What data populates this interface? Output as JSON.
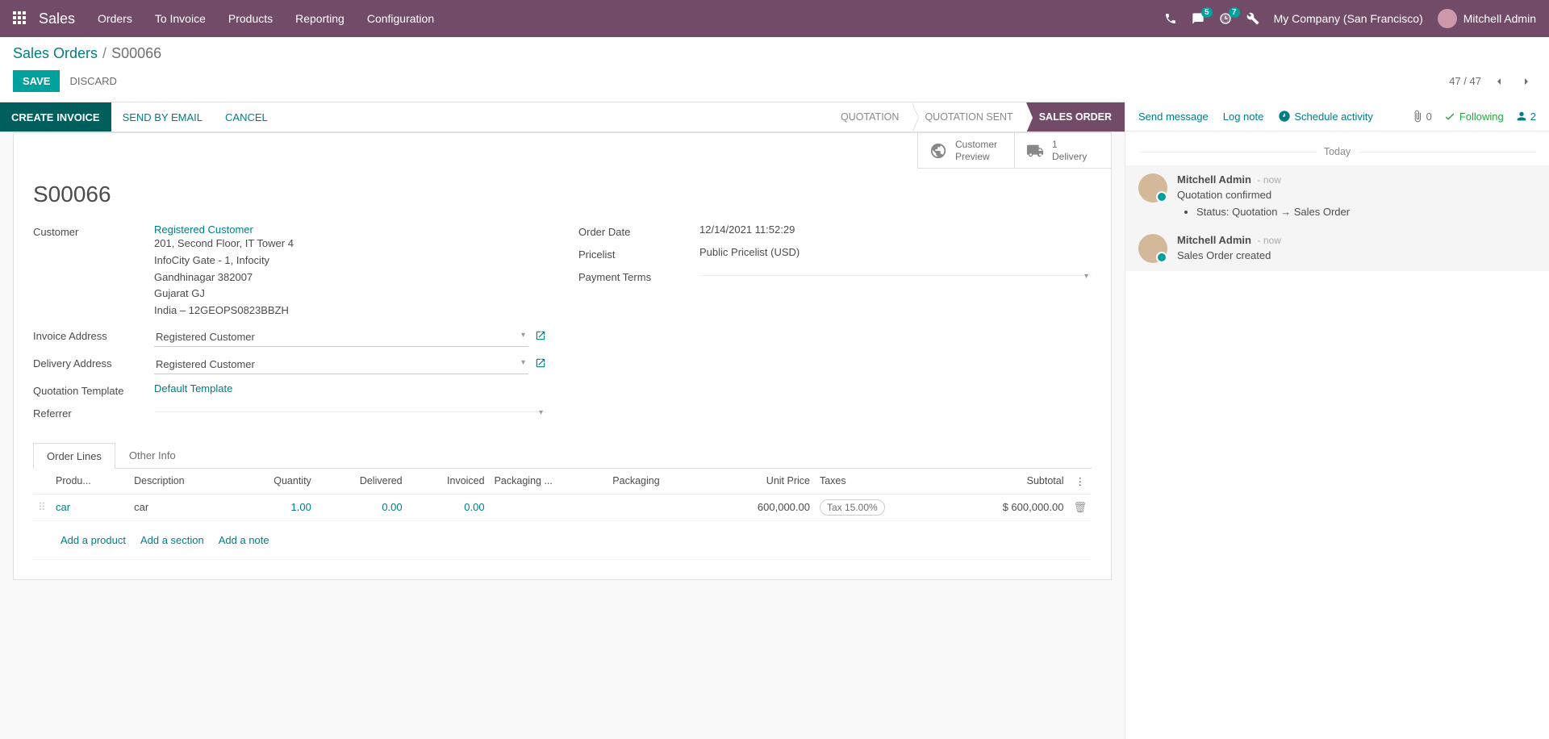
{
  "nav": {
    "brand": "Sales",
    "menu": [
      "Orders",
      "To Invoice",
      "Products",
      "Reporting",
      "Configuration"
    ],
    "chat_badge": "5",
    "activity_badge": "7",
    "company": "My Company (San Francisco)",
    "user": "Mitchell Admin"
  },
  "breadcrumb": {
    "root": "Sales Orders",
    "sep": "/",
    "current": "S00066"
  },
  "actions_top": {
    "save": "SAVE",
    "discard": "DISCARD"
  },
  "pager": {
    "text": "47 / 47"
  },
  "statusbar": {
    "create_invoice": "CREATE INVOICE",
    "send_email": "SEND BY EMAIL",
    "cancel": "CANCEL",
    "stages": [
      "QUOTATION",
      "QUOTATION SENT",
      "SALES ORDER"
    ]
  },
  "stat_buttons": {
    "preview": {
      "l1": "Customer",
      "l2": "Preview"
    },
    "delivery": {
      "count": "1",
      "label": "Delivery"
    }
  },
  "record": {
    "name": "S00066",
    "labels": {
      "customer": "Customer",
      "invoice_addr": "Invoice Address",
      "delivery_addr": "Delivery Address",
      "quote_tmpl": "Quotation Template",
      "referrer": "Referrer",
      "order_date": "Order Date",
      "pricelist": "Pricelist",
      "payment_terms": "Payment Terms"
    },
    "customer_name": "Registered Customer",
    "customer_addr": [
      "201, Second Floor, IT Tower 4",
      "InfoCity Gate - 1, Infocity",
      "Gandhinagar 382007",
      "Gujarat GJ",
      "India – 12GEOPS0823BBZH"
    ],
    "invoice_addr": "Registered Customer",
    "delivery_addr": "Registered Customer",
    "quote_tmpl": "Default Template",
    "order_date": "12/14/2021 11:52:29",
    "pricelist": "Public Pricelist (USD)"
  },
  "tabs": {
    "order_lines": "Order Lines",
    "other_info": "Other Info"
  },
  "lines": {
    "headers": {
      "product": "Produ...",
      "description": "Description",
      "quantity": "Quantity",
      "delivered": "Delivered",
      "invoiced": "Invoiced",
      "packaging_qty": "Packaging ...",
      "packaging": "Packaging",
      "unit_price": "Unit Price",
      "taxes": "Taxes",
      "subtotal": "Subtotal"
    },
    "rows": [
      {
        "product": "car",
        "description": "car",
        "quantity": "1.00",
        "delivered": "0.00",
        "invoiced": "0.00",
        "unit_price": "600,000.00",
        "tax": "Tax 15.00%",
        "subtotal": "$ 600,000.00"
      }
    ],
    "add": {
      "product": "Add a product",
      "section": "Add a section",
      "note": "Add a note"
    }
  },
  "chatter": {
    "send": "Send message",
    "log": "Log note",
    "schedule": "Schedule activity",
    "attach_count": "0",
    "following": "Following",
    "followers_count": "2",
    "today": "Today",
    "messages": [
      {
        "author": "Mitchell Admin",
        "time": "- now",
        "text": "Quotation confirmed",
        "detail_label": "Status: Quotation",
        "detail_to": "Sales Order"
      },
      {
        "author": "Mitchell Admin",
        "time": "- now",
        "text": "Sales Order created"
      }
    ]
  }
}
